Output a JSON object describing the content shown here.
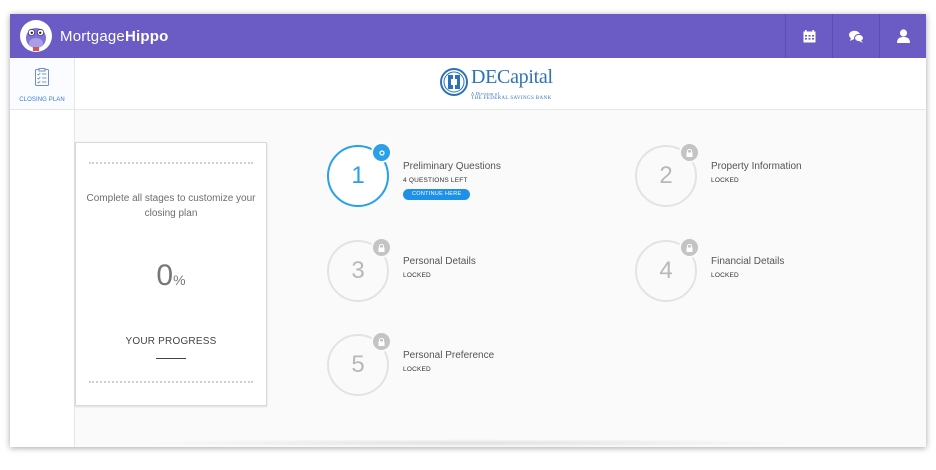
{
  "brand": {
    "name_light": "Mortgage",
    "name_bold": "Hippo"
  },
  "topbar": {
    "actions": [
      {
        "icon": "calendar-icon"
      },
      {
        "icon": "chat-icon"
      },
      {
        "icon": "user-icon"
      }
    ]
  },
  "sidebar": {
    "items": [
      {
        "label": "CLOSING PLAN",
        "icon": "checklist-icon"
      }
    ]
  },
  "partner": {
    "name": "DECapital",
    "tagline": "A Division of",
    "sub": "THE FEDERAL SAVINGS BANK"
  },
  "progress_card": {
    "message": "Complete all stages to customize your closing plan",
    "percent": "0",
    "percent_unit": "%",
    "label": "YOUR PROGRESS"
  },
  "stages": [
    {
      "number": "1",
      "title": "Preliminary Questions",
      "status": "4 QUESTIONS LEFT",
      "cta": "CONTINUE HERE",
      "state": "active"
    },
    {
      "number": "2",
      "title": "Property Information",
      "status": "LOCKED",
      "state": "locked"
    },
    {
      "number": "3",
      "title": "Personal Details",
      "status": "LOCKED",
      "state": "locked"
    },
    {
      "number": "4",
      "title": "Financial Details",
      "status": "LOCKED",
      "state": "locked"
    },
    {
      "number": "5",
      "title": "Personal Preference",
      "status": "LOCKED",
      "state": "locked"
    }
  ],
  "colors": {
    "topbar": "#6a5cc4",
    "accent": "#2aa0e8",
    "cta": "#1e90e8",
    "locked_badge": "#c4c4c4",
    "partner": "#2d72b8"
  }
}
